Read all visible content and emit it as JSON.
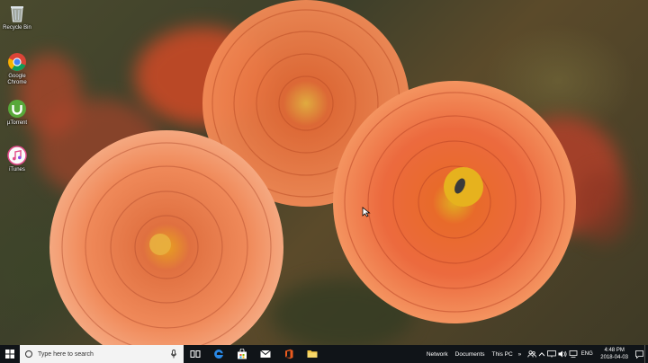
{
  "desktop": {
    "icons": [
      {
        "label": "Recycle Bin",
        "icon": "recycle-bin-icon"
      },
      {
        "label": "Google Chrome",
        "icon": "chrome-icon"
      },
      {
        "label": "µTorrent",
        "icon": "utorrent-icon"
      },
      {
        "label": "iTunes",
        "icon": "itunes-icon"
      }
    ]
  },
  "taskbar": {
    "search_placeholder": "Type here to search",
    "apps": [
      "task-view-icon",
      "edge-icon",
      "store-icon",
      "mail-icon",
      "office-icon",
      "file-explorer-icon"
    ],
    "toolbars": [
      "Network",
      "Documents",
      "This PC"
    ],
    "overflow_label": "»",
    "language": "ENG",
    "time": "4:48 PM",
    "date": "2018-04-03"
  },
  "colors": {
    "taskbar_bg": "#101418",
    "search_bg": "#f3f3f3",
    "petal_orange": "#e8643a",
    "petal_light": "#f28a56",
    "flower_center": "#e0b020"
  }
}
